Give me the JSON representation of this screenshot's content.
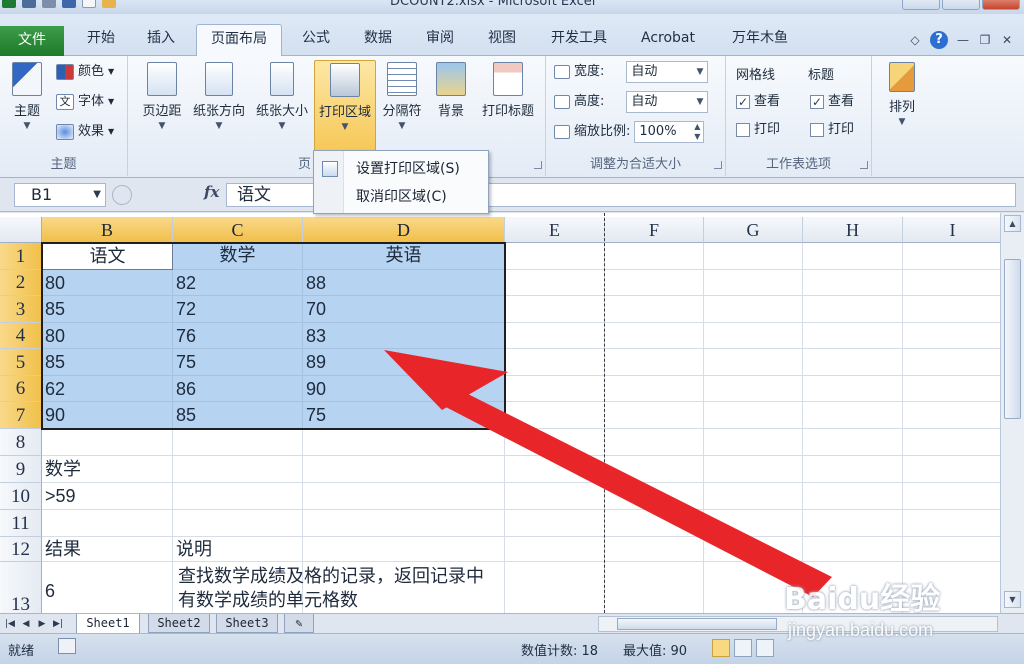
{
  "window": {
    "title": "DCOUNT2.xlsx - Microsoft Excel"
  },
  "ribbon_tabs": [
    "文件",
    "开始",
    "插入",
    "页面布局",
    "公式",
    "数据",
    "审阅",
    "视图",
    "开发工具",
    "Acrobat",
    "万年木鱼"
  ],
  "active_tab": "页面布局",
  "ribbon": {
    "theme_group": {
      "label": "主题",
      "theme_button": "主题",
      "colors": "颜色",
      "fonts": "字体",
      "effects": "效果"
    },
    "page_setup_group": {
      "label": "页",
      "margins": "页边距",
      "orientation": "纸张方向",
      "size": "纸张大小",
      "print_area": "打印区域",
      "breaks": "分隔符",
      "background": "背景",
      "print_titles": "打印标题"
    },
    "scale_group": {
      "label": "调整为合适大小",
      "width_label": "宽度:",
      "width_value": "自动",
      "height_label": "高度:",
      "height_value": "自动",
      "scale_label": "缩放比例:",
      "scale_value": "100%"
    },
    "sheet_options_group": {
      "label": "工作表选项",
      "gridlines": "网格线",
      "headings": "标题",
      "view": "查看",
      "print": "打印"
    },
    "arrange_group": {
      "arrange": "排列"
    }
  },
  "print_area_menu": {
    "set": "设置打印区域(S)",
    "clear": "取消印区域(C)"
  },
  "formula_bar": {
    "name_box": "B1",
    "fx": "fx",
    "value": "语文"
  },
  "columns": [
    "B",
    "C",
    "D",
    "E",
    "F",
    "G",
    "H",
    "I"
  ],
  "rows": [
    "1",
    "2",
    "3",
    "4",
    "5",
    "6",
    "7",
    "8",
    "9",
    "10",
    "11",
    "12",
    "13"
  ],
  "table": {
    "headers": [
      "语文",
      "数学",
      "英语"
    ],
    "rows": [
      [
        "80",
        "82",
        "88"
      ],
      [
        "85",
        "72",
        "70"
      ],
      [
        "80",
        "76",
        "83"
      ],
      [
        "85",
        "75",
        "89"
      ],
      [
        "62",
        "86",
        "90"
      ],
      [
        "90",
        "85",
        "75"
      ]
    ]
  },
  "criteria": {
    "field": "数学",
    "condition": ">59"
  },
  "result": {
    "label": "结果",
    "desc_label": "说明",
    "value": "6",
    "description": "查找数学成绩及格的记录，返回记录中有数学成绩的单元格数"
  },
  "sheets": [
    "Sheet1",
    "Sheet2",
    "Sheet3"
  ],
  "active_sheet": "Sheet1",
  "status": {
    "ready": "就绪",
    "count": "数值计数: 18",
    "max": "最大值: 90"
  },
  "watermark": {
    "logo": "Baidu经验",
    "url": "jingyan.baidu.com"
  },
  "colors": {
    "selection": "#b6d3f2",
    "selected_header": "#f1c04a",
    "file_tab": "#1c7a29",
    "annotation_arrow": "#e8262a"
  }
}
